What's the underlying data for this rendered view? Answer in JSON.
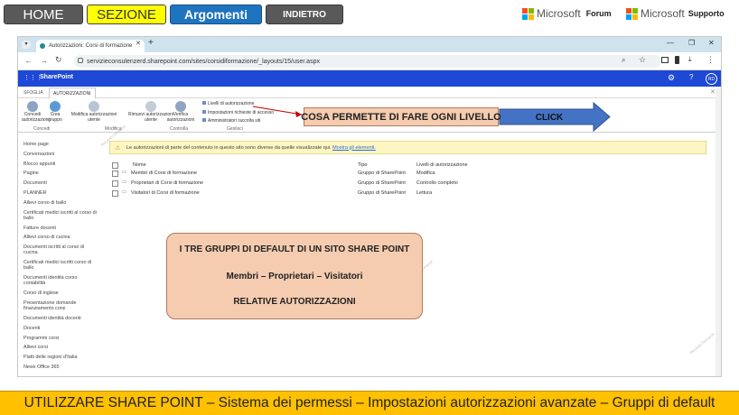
{
  "nav": {
    "home": "HOME",
    "sezione": "SEZIONE",
    "argomenti": "Argomenti",
    "indietro": "INDIETRO",
    "ms_forum_brand": "Microsoft",
    "ms_forum_label": "Forum",
    "ms_support_brand": "Microsoft",
    "ms_support_label": "Supporto"
  },
  "browser": {
    "tab_title": "Autorizzazioni: Corsi di formazione",
    "url": "servizieconsulenzerd.sharepoint.com/sites/corsidiformazione/_layouts/15/user.aspx"
  },
  "sharepoint": {
    "app_name": "SharePoint",
    "user_initials": "RD",
    "ribbon_tabs": [
      "SFOGLIA",
      "AUTORIZZAZIONI"
    ],
    "ribbon": {
      "concedi": "Concedi autorizzazioni",
      "crea": "Crea gruppo",
      "modifica_aut": "Modifica autorizzazioni utente",
      "rimuovi_aut": "Rimuovi autorizzazioni utente",
      "verifica": "Verifica autorizzazioni",
      "livelli": "Livelli di autorizzazione",
      "impostazioni": "Impostazioni richieste di accesso",
      "amministratori": "Amministratori raccolta siti",
      "grp_concedi": "Concedi",
      "grp_modifica": "Modifica",
      "grp_controlla": "Controlla",
      "grp_gestisci": "Gestisci"
    },
    "left_nav": [
      "Home page",
      "Conversazioni",
      "Blocco appunti",
      "Pagine",
      "Documenti",
      "PLANNER",
      "Allievi corso di ballo",
      "Certificati medici iscritti al corso di ballo",
      "Fatture docenti",
      "Allievi corso di cucina",
      "Documenti iscritti al corso di cucina",
      "Certificati medici iscritti corso di ballo",
      "Documenti identità corso contabilità",
      "Corso di inglese",
      "Presentazione domande finanziamento corsi",
      "Documenti identità docenti",
      "Docenti",
      "Programmi corsi",
      "Allievi corsi",
      "Piatti delle regioni d'Italia",
      "News Office 365"
    ],
    "warning_text": "Le autorizzazioni di parte del contenuto in questo sito sono diverse da quelle visualizzate qui.",
    "warning_link": "Mostra gli elementi.",
    "table": {
      "headers": [
        "Nome",
        "Tipo",
        "Livelli di autorizzazione"
      ],
      "rows": [
        [
          "Membri di Corsi di formazione",
          "Gruppo di SharePoint",
          "Modifica"
        ],
        [
          "Proprietari di Corsi di formazione",
          "Gruppo di SharePoint",
          "Controllo completo"
        ],
        [
          "Visitatori di Corsi di formazione",
          "Gruppo di SharePoint",
          "Lettura"
        ]
      ]
    }
  },
  "callouts": {
    "livello": "COSA PERMETTE DI FARE OGNI LIVELLO",
    "click": "CLICK",
    "box_line1": "I TRE GRUPPI DI DEFAULT DI UN SITO SHARE POINT",
    "box_line2": "Membri – Proprietari – Visitatori",
    "box_line3": "RELATIVE AUTORIZZAZIONI"
  },
  "footer": "UTILIZZARE SHARE POINT – Sistema dei permessi – Impostazioni autorizzazioni avanzate – Gruppi di default",
  "watermark": "Riccardo Demarchi",
  "colors": {
    "sharepoint_bar": "#1d49d6",
    "callout_fill": "#f5ccb0",
    "arrow_fill": "#4472c4",
    "footer_fill": "#ffc000",
    "sezione_fill": "#ffff00",
    "argomenti_fill": "#1f74bf"
  }
}
